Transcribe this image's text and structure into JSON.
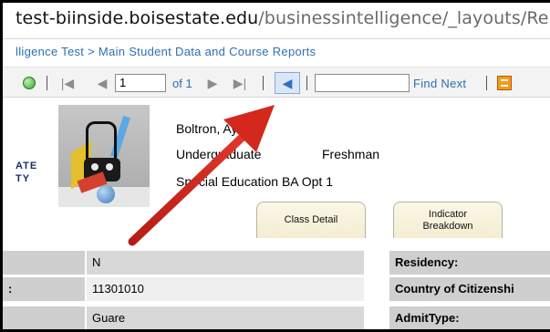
{
  "browser": {
    "url_host": "test-biinside.boisestate.edu",
    "url_path": "/businessintelligence/_layouts/ReportS"
  },
  "breadcrumb": {
    "text": "lligence Test > Main Student Data and Course Reports"
  },
  "toolbar": {
    "page_value": "1",
    "of_pages": "of 1",
    "find_value": "",
    "find_next_label": "Find Next",
    "separator": "|"
  },
  "logo": {
    "line1": "ATE",
    "line2": "TY"
  },
  "student": {
    "name": "Boltron, Ay",
    "level": "Undergraduate",
    "class_level": "Freshman",
    "major": "Special Education BA Opt 1"
  },
  "tabs": [
    {
      "label": "Class Detail"
    },
    {
      "label": "Indicator Breakdown"
    }
  ],
  "rows": [
    {
      "label": "",
      "value": "N",
      "right_label": "Residency:"
    },
    {
      "label": ":",
      "value": "11301010",
      "right_label": "Country of Citizenshi"
    },
    {
      "label": "",
      "value": "Guare",
      "right_label": "AdmitType:"
    }
  ],
  "colors": {
    "annotation_arrow": "#d4281c",
    "link": "#2e6fb3",
    "label_cell": "#cfcfcf"
  },
  "icons": {
    "refresh": "refresh-icon",
    "first_page": "first-page-icon",
    "prev_page": "previous-page-icon",
    "next_page": "next-page-icon",
    "last_page": "last-page-icon",
    "back": "back-to-parent-icon",
    "export": "export-icon"
  }
}
